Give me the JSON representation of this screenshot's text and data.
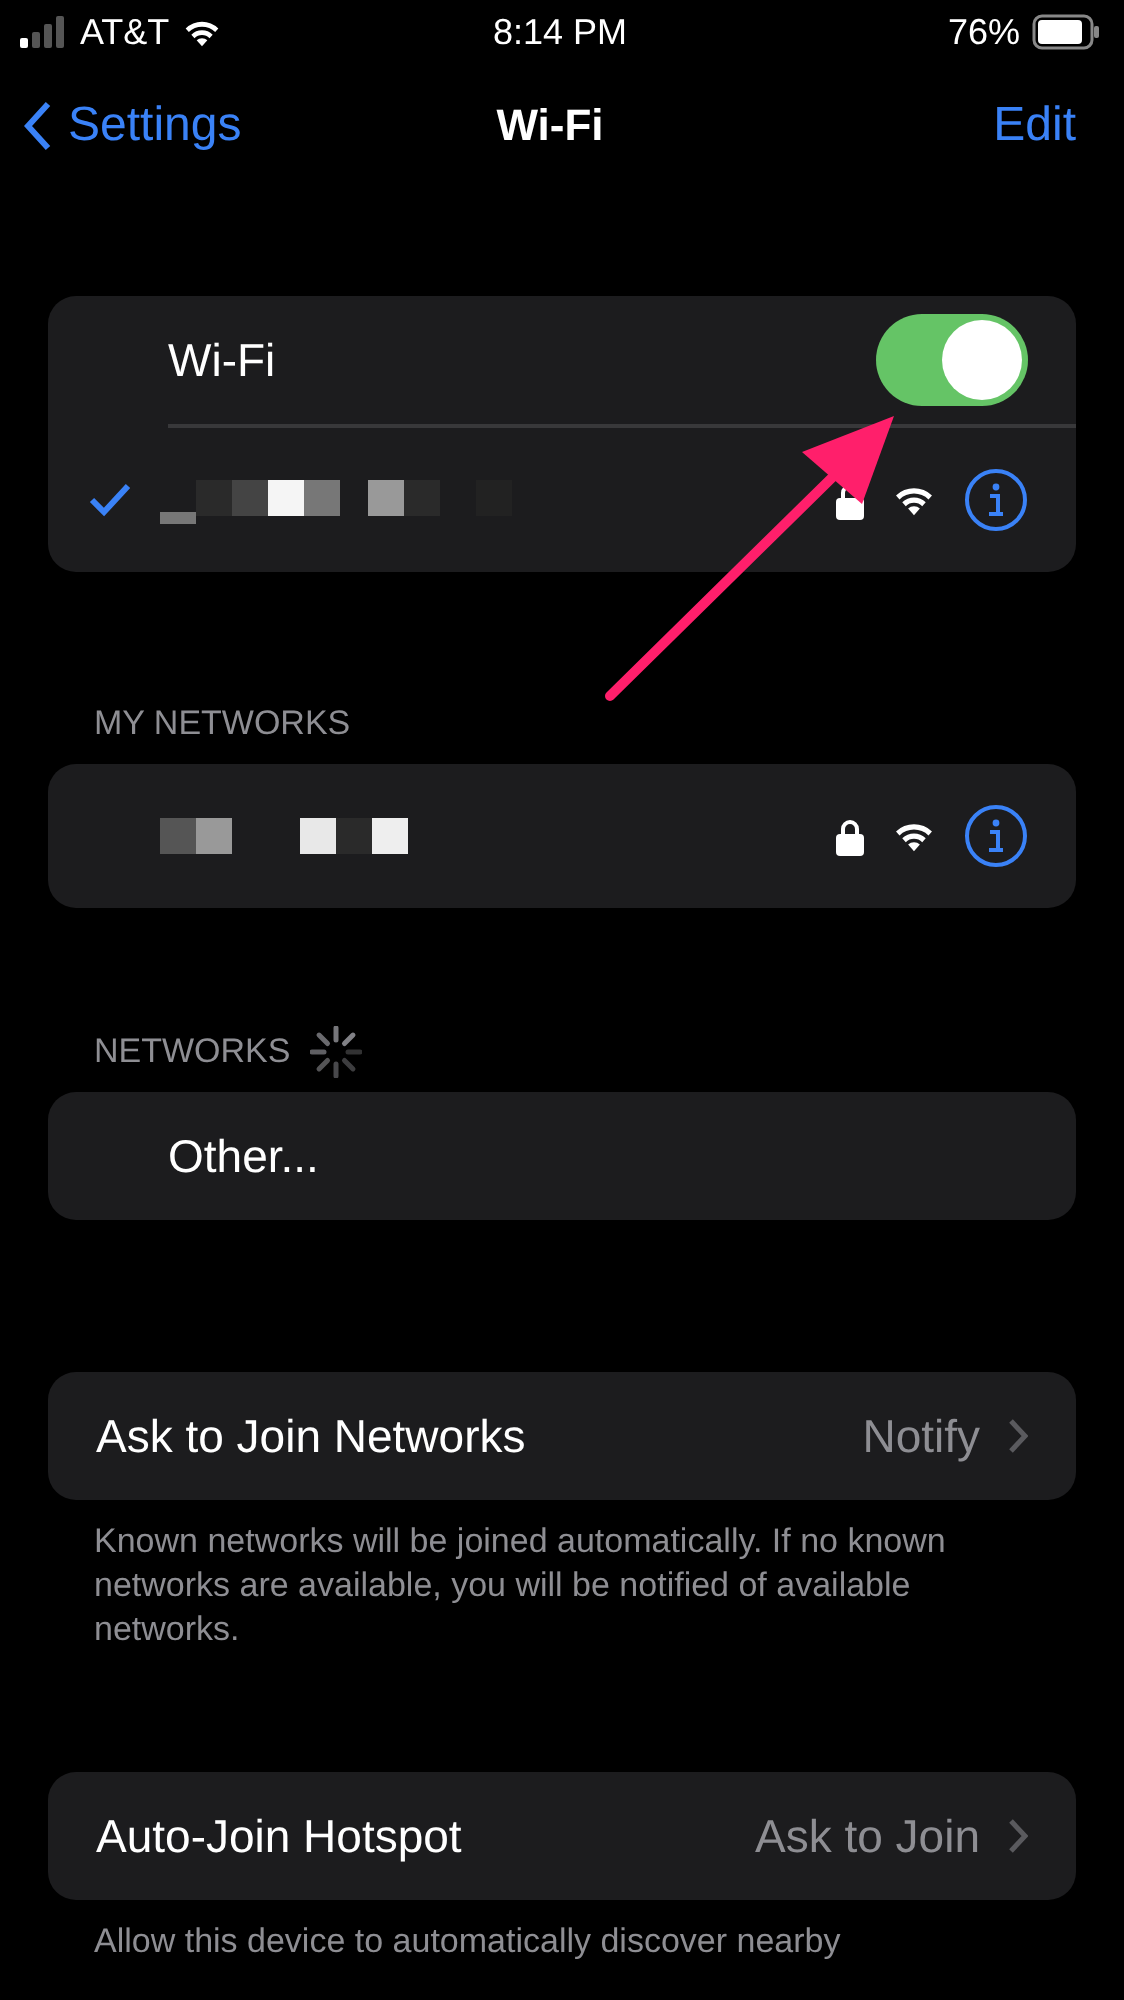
{
  "status_bar": {
    "carrier": "AT&T",
    "time": "8:14 PM",
    "battery": "76%"
  },
  "nav": {
    "back": "Settings",
    "title": "Wi-Fi",
    "action": "Edit"
  },
  "wifi_card": {
    "label": "Wi-Fi",
    "on": true,
    "current_network": {
      "connected": true,
      "locked": true
    }
  },
  "my_networks": {
    "header": "MY NETWORKS",
    "networks": [
      {
        "locked": true
      }
    ]
  },
  "networks": {
    "header": "NETWORKS",
    "loading": true,
    "items": [
      {
        "label": "Other..."
      }
    ]
  },
  "settings": [
    {
      "label": "Ask to Join Networks",
      "value": "Notify",
      "footer": "Known networks will be joined automatically. If no known networks are available, you will be notified of available networks."
    },
    {
      "label": "Auto-Join Hotspot",
      "value": "Ask to Join",
      "footer": "Allow this device to automatically discover nearby"
    }
  ]
}
